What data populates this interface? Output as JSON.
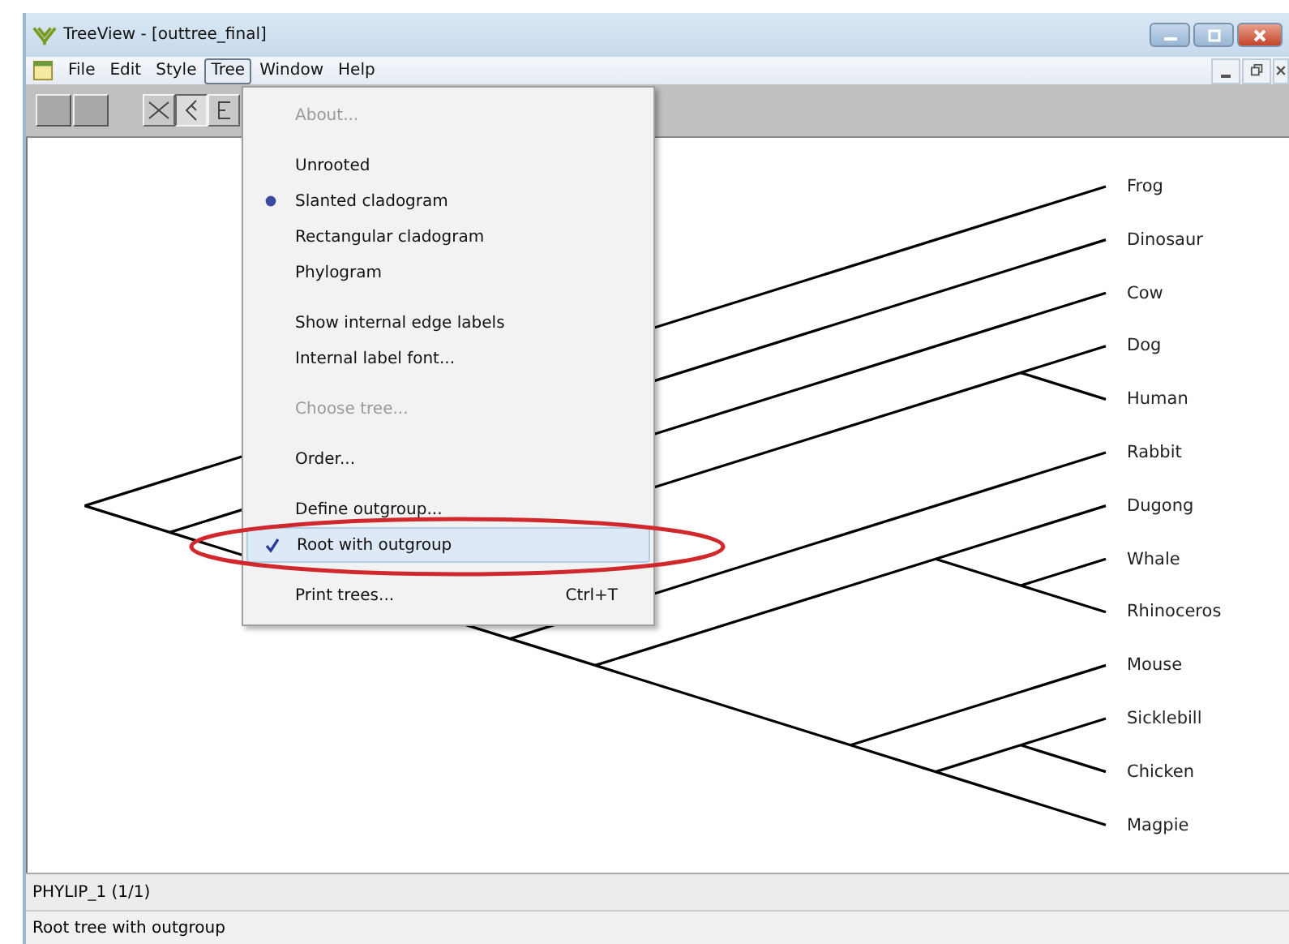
{
  "window": {
    "title": "TreeView - [outtree_final]"
  },
  "menubar": [
    {
      "label": "File",
      "selected": false
    },
    {
      "label": "Edit",
      "selected": false
    },
    {
      "label": "Style",
      "selected": false
    },
    {
      "label": "Tree",
      "selected": true
    },
    {
      "label": "Window",
      "selected": false
    },
    {
      "label": "Help",
      "selected": false
    }
  ],
  "menu": {
    "groups": [
      [
        {
          "label": "About...",
          "kind": "plain",
          "disabled": true,
          "selected": false
        }
      ],
      [
        {
          "label": "Unrooted",
          "kind": "radio",
          "checked": false,
          "disabled": false,
          "selected": false
        },
        {
          "label": "Slanted cladogram",
          "kind": "radio",
          "checked": true,
          "disabled": false,
          "selected": false
        },
        {
          "label": "Rectangular cladogram",
          "kind": "radio",
          "checked": false,
          "disabled": false,
          "selected": false
        },
        {
          "label": "Phylogram",
          "kind": "radio",
          "checked": false,
          "disabled": false,
          "selected": false
        }
      ],
      [
        {
          "label": "Show internal edge labels",
          "kind": "check",
          "checked": false,
          "disabled": false,
          "selected": false
        },
        {
          "label": "Internal label font...",
          "kind": "plain",
          "disabled": false,
          "selected": false
        }
      ],
      [
        {
          "label": "Choose tree...",
          "kind": "plain",
          "disabled": true,
          "selected": false
        }
      ],
      [
        {
          "label": "Order...",
          "kind": "plain",
          "disabled": false,
          "selected": false
        }
      ],
      [
        {
          "label": "Define outgroup...",
          "kind": "plain",
          "disabled": false,
          "selected": false
        },
        {
          "label": "Root with outgroup",
          "kind": "check",
          "checked": true,
          "disabled": false,
          "selected": true
        }
      ],
      [
        {
          "label": "Print trees...",
          "kind": "plain",
          "disabled": false,
          "selected": false,
          "shortcut": "Ctrl+T"
        }
      ]
    ]
  },
  "tree": {
    "children": [
      {
        "name": "Frog"
      },
      {
        "children": [
          {
            "name": "Dinosaur"
          },
          {
            "children": [
              {
                "name": "Cow"
              },
              {
                "children": [
                  {
                    "children": [
                      {
                        "name": "Dog"
                      },
                      {
                        "name": "Human"
                      }
                    ]
                  },
                  {
                    "children": [
                      {
                        "name": "Rabbit"
                      },
                      {
                        "children": [
                          {
                            "children": [
                              {
                                "name": "Dugong"
                              },
                              {
                                "children": [
                                  {
                                    "name": "Whale"
                                  },
                                  {
                                    "name": "Rhinoceros"
                                  }
                                ]
                              }
                            ]
                          },
                          {
                            "children": [
                              {
                                "name": "Mouse"
                              },
                              {
                                "children": [
                                  {
                                    "children": [
                                      {
                                        "name": "Sicklebill"
                                      },
                                      {
                                        "name": "Chicken"
                                      }
                                    ]
                                  },
                                  {
                                    "name": "Magpie"
                                  }
                                ]
                              }
                            ]
                          }
                        ]
                      }
                    ]
                  }
                ]
              }
            ]
          }
        ]
      }
    ]
  },
  "tree_name": "PHYLIP_1  (1/1)",
  "status_bar": "Root tree with outgroup"
}
